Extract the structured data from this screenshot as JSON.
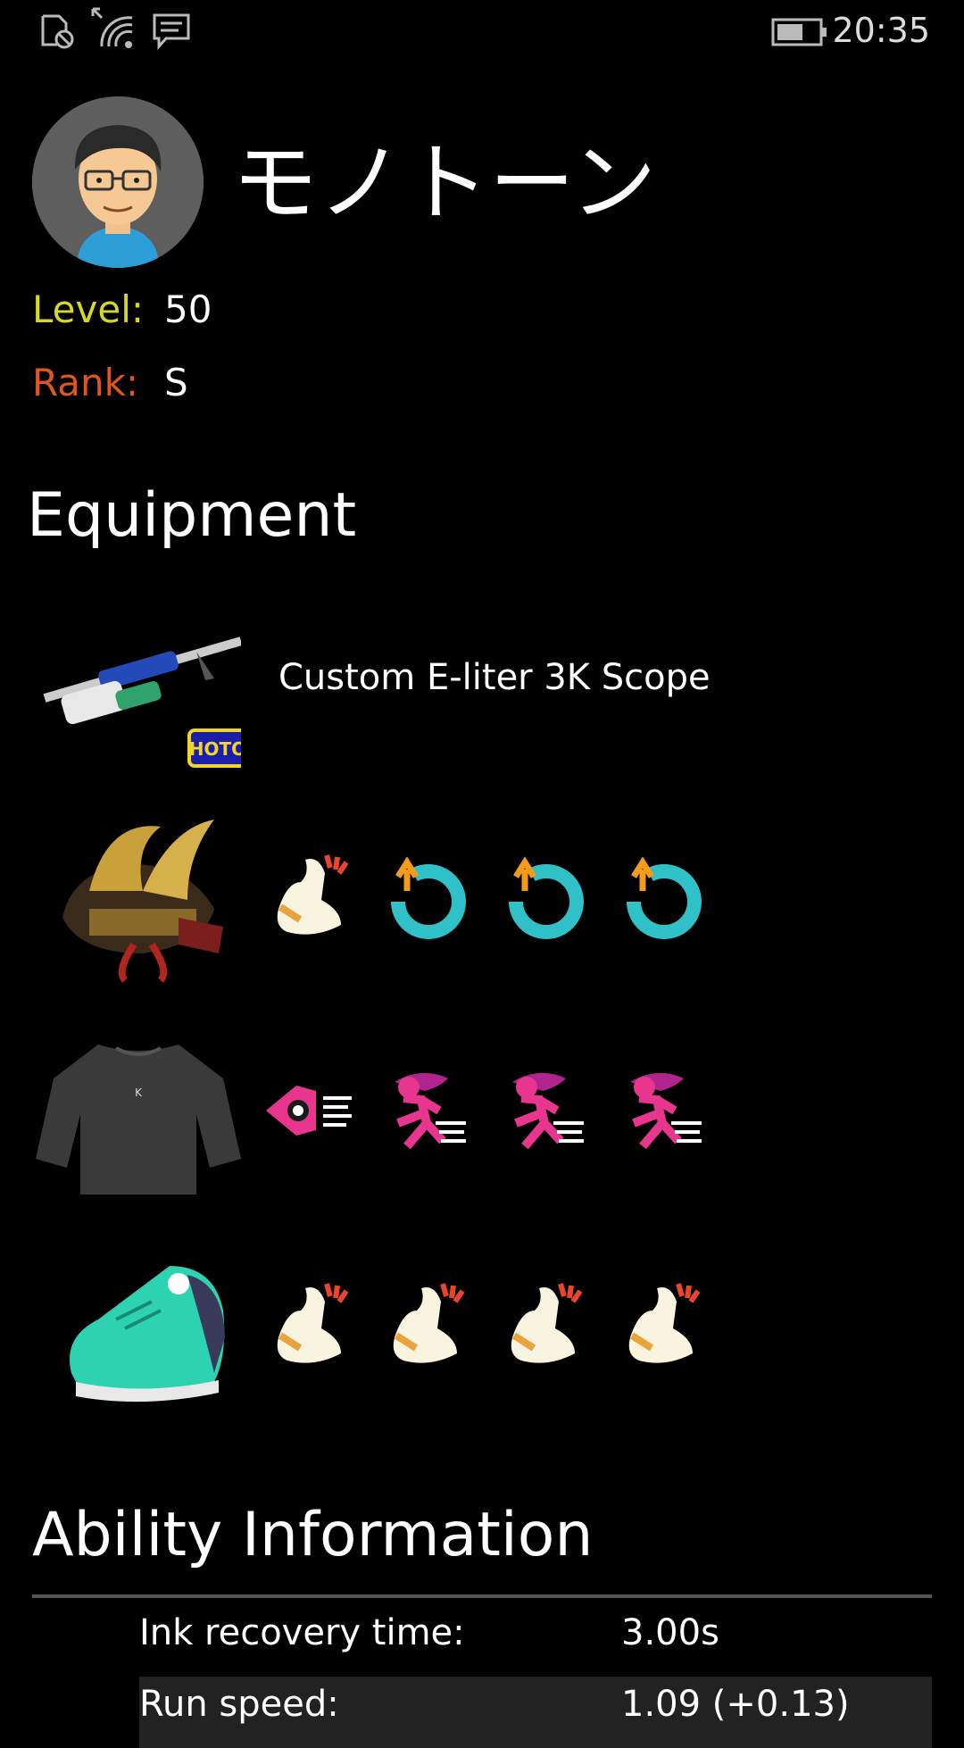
{
  "status_bar": {
    "time": "20:35",
    "icons": [
      "rotation-lock-icon",
      "wifi-icon",
      "message-icon",
      "battery-icon"
    ]
  },
  "profile": {
    "name": "モノトーン",
    "level_label": "Level:",
    "level_value": "50",
    "rank_label": "Rank:",
    "rank_value": "S"
  },
  "equipment": {
    "title": "Equipment",
    "weapon": {
      "name": "Custom E-liter 3K Scope",
      "brand_badge": "HOTO"
    },
    "headgear": {
      "main": "damage-up",
      "subs": [
        "ink-recovery-up",
        "ink-recovery-up",
        "ink-recovery-up"
      ]
    },
    "clothing": {
      "main": "swim-speed-up",
      "subs": [
        "run-speed-up",
        "run-speed-up",
        "run-speed-up"
      ]
    },
    "shoes": {
      "main": "damage-up",
      "subs": [
        "damage-up",
        "damage-up",
        "damage-up"
      ]
    }
  },
  "ability_info": {
    "title": "Ability Information",
    "rows": [
      {
        "label": "Ink recovery time:",
        "value": "3.00s"
      },
      {
        "label": "Run speed:",
        "value": "1.09 (+0.13)"
      }
    ]
  },
  "colors": {
    "level": "#d7d62a",
    "rank": "#e0561c",
    "background": "#000000",
    "row_alt": "#222222"
  }
}
